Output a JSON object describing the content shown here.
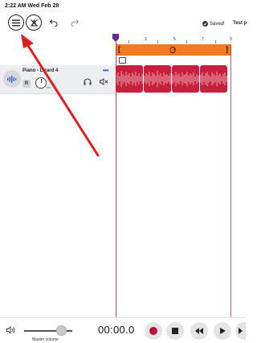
{
  "status_bar": {
    "time_date": "2:22 AM   Wed Feb 28"
  },
  "toolbar": {
    "saved_label": "Saved!",
    "project_title": "Test p"
  },
  "ruler": {
    "ticks": [
      "3",
      "5",
      "7",
      "9"
    ]
  },
  "track": {
    "name": "Piano - Lizard 4",
    "record_label": "R",
    "knob_label": "Vol",
    "more_label": "•••"
  },
  "bottom": {
    "master_volume_label": "Master volume",
    "time": "00:00.0",
    "master_volume": 0.7
  },
  "colors": {
    "loop_bar": "#f47a1f",
    "region": "#c8203c",
    "playhead": "#c8203c",
    "record": "#b3103a",
    "annotation_arrow": "#e01e1e"
  },
  "icons": [
    "menu-icon",
    "no-metronome-icon",
    "undo-icon",
    "redo-icon",
    "check-icon",
    "waveform-icon",
    "headphones-icon",
    "mute-icon",
    "marker-icon",
    "loop-icon",
    "volume-icon",
    "record-icon",
    "stop-icon",
    "rewind-icon",
    "play-icon",
    "forward-icon"
  ]
}
